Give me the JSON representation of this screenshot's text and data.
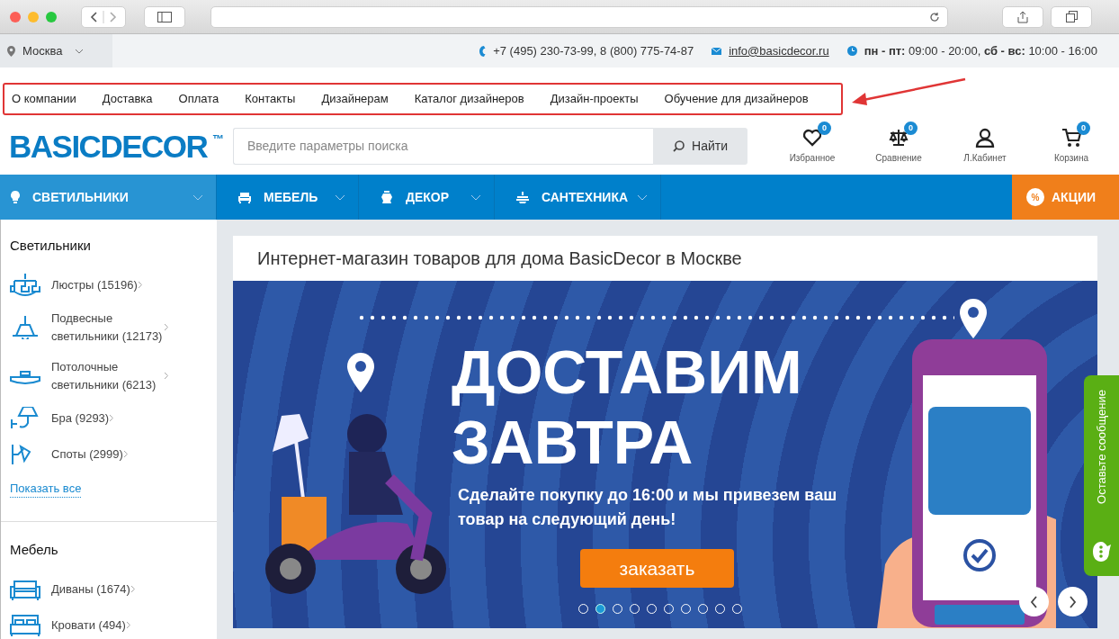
{
  "topbar": {
    "city": "Москва",
    "phones": "+7 (495) 230-73-99, 8 (800) 775-74-87",
    "email": "info@basicdecor.ru",
    "hours": "**пн - пт:** 09:00 - 20:00, **сб - вс:** 10:00 - 16:00"
  },
  "top_links": [
    "О компании",
    "Доставка",
    "Оплата",
    "Контакты",
    "Дизайнерам",
    "Каталог дизайнеров",
    "Дизайн-проекты",
    "Обучение для дизайнеров"
  ],
  "header": {
    "logo": "BASICDECOR",
    "logo_mark": "™",
    "search": {
      "placeholder": "Введите параметры поиска",
      "button": "Найти"
    },
    "actions": [
      {
        "kind": "heart",
        "label": "Избранное",
        "count": "0"
      },
      {
        "kind": "scales",
        "label": "Сравнение",
        "count": "0"
      },
      {
        "kind": "user",
        "label": "Л.Кабинет"
      },
      {
        "kind": "cart",
        "label": "Корзина",
        "count": "0"
      }
    ]
  },
  "catalog_nav": [
    {
      "kind": "lamp",
      "label": "СВЕТИЛЬНИКИ",
      "selected": true
    },
    {
      "kind": "chair",
      "label": "МЕБЕЛЬ",
      "selected": false
    },
    {
      "kind": "vase",
      "label": "ДЕКОР",
      "selected": false
    },
    {
      "kind": "faucet",
      "label": "САНТЕХНИКА",
      "selected": false
    }
  ],
  "promo": {
    "label": "АКЦИИ",
    "icon_text": "%"
  },
  "sidebar": [
    {
      "title": "Светильники",
      "items": [
        {
          "kind": "chandelier",
          "label": "Люстры (15196)"
        },
        {
          "kind": "pendant",
          "label": "Подвесные светильники (12173)"
        },
        {
          "kind": "ceiling",
          "label": "Потолочные светильники (6213)"
        },
        {
          "kind": "sconce",
          "label": "Бра (9293)"
        },
        {
          "kind": "spot",
          "label": "Споты (2999)"
        }
      ],
      "more": "Показать все"
    },
    {
      "title": "Мебель",
      "items": [
        {
          "kind": "sofa",
          "label": "Диваны (1674)"
        },
        {
          "kind": "bed",
          "label": "Кровати (494)"
        }
      ]
    }
  ],
  "main": {
    "title": "Интернет-магазин товаров для дома BasicDecor в Москве",
    "banner": {
      "headline": [
        "ДОСТАВИМ",
        "ЗАВТРА"
      ],
      "text": "Сделайте покупку до 16:00 и мы привезем ваш товар на следующий день!",
      "button": "заказать",
      "dots": [
        {
          "selected": false
        },
        {
          "selected": true
        },
        {
          "selected": false
        },
        {
          "selected": false
        },
        {
          "selected": false
        },
        {
          "selected": false
        },
        {
          "selected": false
        },
        {
          "selected": false
        },
        {
          "selected": false
        },
        {
          "selected": false
        }
      ]
    }
  },
  "feedback_tab": {
    "label": "Оставьте сообщение"
  }
}
